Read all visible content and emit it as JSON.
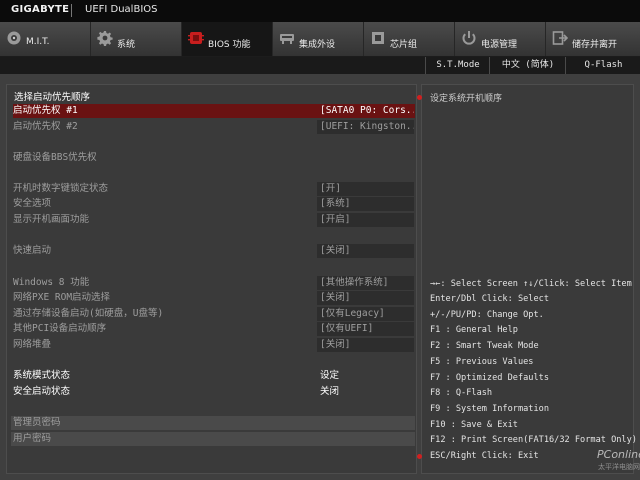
{
  "header": {
    "brand": "GIGABYTE",
    "product": "UEFI DualBIOS"
  },
  "tabs": [
    {
      "label": "M.I.T.",
      "icon": "cog-dial-icon"
    },
    {
      "label": "系统",
      "icon": "gear-icon"
    },
    {
      "label": "BIOS 功能",
      "icon": "bios-chip-icon",
      "active": true
    },
    {
      "label": "集成外设",
      "icon": "peripheral-icon"
    },
    {
      "label": "芯片组",
      "icon": "chipset-icon"
    },
    {
      "label": "电源管理",
      "icon": "power-icon"
    },
    {
      "label": "储存并离开",
      "icon": "exit-icon"
    }
  ],
  "subbar": {
    "st_mode": "S.T.Mode",
    "language": "中文 (简体)",
    "qflash": "Q-Flash"
  },
  "main": {
    "boot_priority_title": "选择启动优先顺序",
    "boot1": {
      "label": "启动优先权 #1",
      "value": "[SATA0 P0: Cors...]"
    },
    "boot2": {
      "label": "启动优先权 #2",
      "value": "[UEFI: Kingston...]"
    },
    "hdd_bbs": "硬盘设备BBS优先权",
    "numlock": {
      "label": "开机时数字键锁定状态",
      "value": "[开]"
    },
    "security": {
      "label": "安全选项",
      "value": "[系统]"
    },
    "logo": {
      "label": "显示开机画面功能",
      "value": "[开启]"
    },
    "fastboot": {
      "label": "快速启动",
      "value": "[关闭]"
    },
    "win8": {
      "label": "Windows 8 功能",
      "value": "[其他操作系统]"
    },
    "pxe": {
      "label": "网络PXE ROM启动选择",
      "value": "[关闭]"
    },
    "storage": {
      "label": "通过存储设备启动(如硬盘，U盘等)",
      "value": "[仅有Legacy]"
    },
    "pci": {
      "label": "其他PCI设备启动顺序",
      "value": "[仅有UEFI]"
    },
    "netstack": {
      "label": "网络堆叠",
      "value": "[关闭]"
    },
    "sysmode": {
      "label": "系统模式状态",
      "value": "设定"
    },
    "secureboot": {
      "label": "安全启动状态",
      "value": "关闭"
    },
    "admin_pw": "管理员密码",
    "user_pw": "用户密码"
  },
  "help": {
    "description": "设定系统开机顺序",
    "keys": [
      "→←: Select Screen  ↑↓/Click: Select Item",
      "Enter/Dbl Click: Select",
      "+/-/PU/PD: Change Opt.",
      "F1  : General Help",
      "F2  : Smart Tweak Mode",
      "F5  : Previous Values",
      "F7  : Optimized Defaults",
      "F8  : Q-Flash",
      "F9  : System Information",
      "F10 : Save & Exit",
      "F12 : Print Screen(FAT16/32 Format Only)",
      "ESC/Right Click: Exit"
    ]
  },
  "watermark": {
    "text": "PConline",
    "sub": "太平洋电脑网"
  },
  "colors": {
    "accent": "#6a1212",
    "dot": "#d12020",
    "bg": "#3f3f3f"
  }
}
